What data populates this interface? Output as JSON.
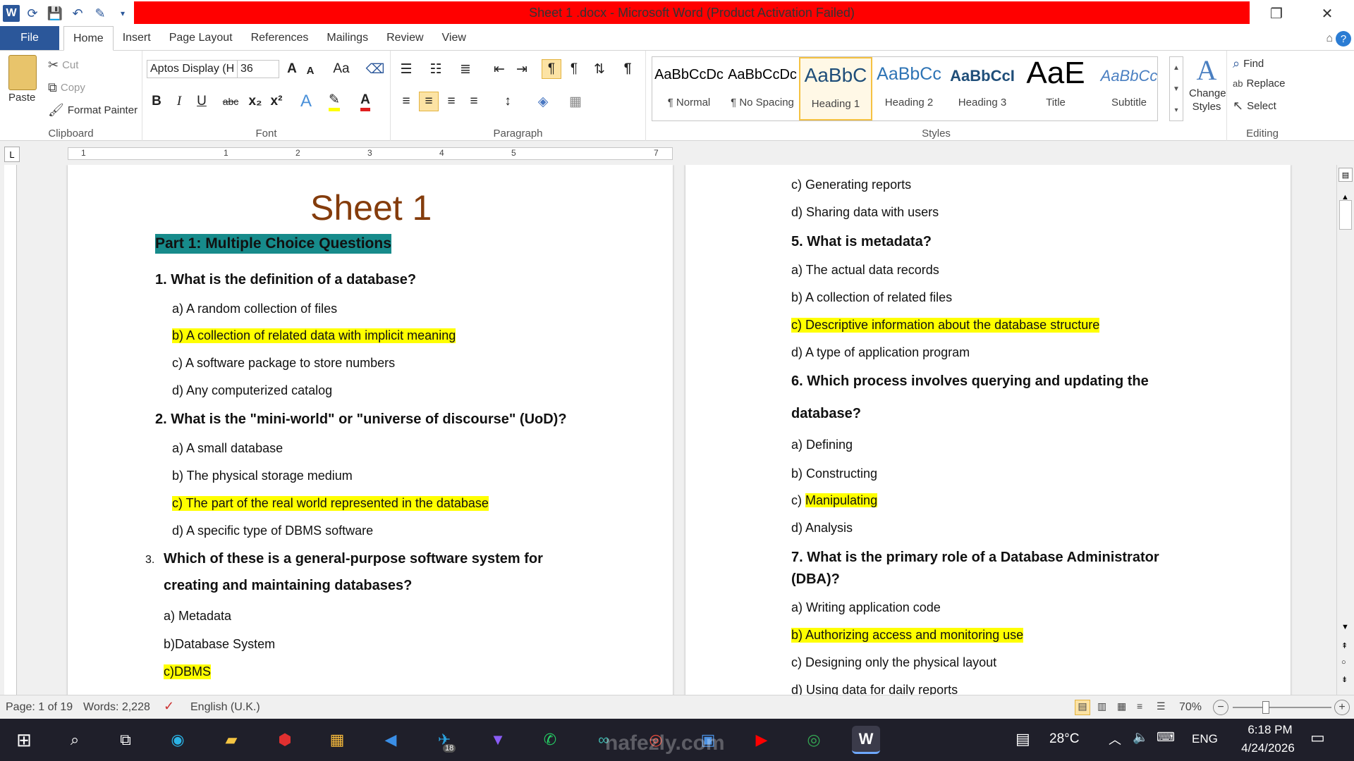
{
  "titlebar": {
    "title": "Sheet 1 .docx  -  Microsoft Word (Product Activation Failed)",
    "restore": "❐",
    "close": "✕"
  },
  "tabs": [
    "File",
    "Home",
    "Insert",
    "Page Layout",
    "References",
    "Mailings",
    "Review",
    "View"
  ],
  "clipboard": {
    "paste": "Paste",
    "cut": "Cut",
    "copy": "Copy",
    "format_painter": "Format Painter",
    "label": "Clipboard"
  },
  "font": {
    "name": "Aptos Display (H",
    "size": "36",
    "label": "Font",
    "bold": "B",
    "italic": "I",
    "underline": "U",
    "strike": "abc",
    "sub": "x₂",
    "sup": "x²",
    "grow": "A",
    "shrink": "A",
    "case": "Aa"
  },
  "paragraph": {
    "label": "Paragraph"
  },
  "styles": {
    "label": "Styles",
    "items": [
      {
        "sample": "AaBbCcDc",
        "name": "¶ Normal"
      },
      {
        "sample": "AaBbCcDc",
        "name": "¶ No Spacing"
      },
      {
        "sample": "AaBbC",
        "name": "Heading 1"
      },
      {
        "sample": "AaBbCc",
        "name": "Heading 2"
      },
      {
        "sample": "AaBbCcI",
        "name": "Heading 3"
      },
      {
        "sample": "AaE",
        "name": "Title"
      },
      {
        "sample": "AaBbCc",
        "name": "Subtitle"
      }
    ],
    "change_styles": "Change Styles"
  },
  "editing": {
    "find": "Find",
    "replace": "Replace",
    "select": "Select",
    "label": "Editing"
  },
  "ruler": {
    "marks": [
      "1",
      "1",
      "2",
      "3",
      "4",
      "5",
      "7"
    ],
    "corner": "L"
  },
  "page1": {
    "title": "Sheet 1",
    "part": "Part 1: Multiple Choice Questions",
    "q1": "1.  What is the definition of a database?",
    "q1a": "a) A random collection of files",
    "q1b": "b) A collection of related data with implicit meaning",
    "q1c": "c)  A software package to store numbers",
    "q1d": "d) Any computerized catalog",
    "q2": "2.  What is the \"mini-world\" or \"universe of discourse\" (UoD)?",
    "q2a": "a)  A small database",
    "q2b": "b) The physical storage medium",
    "q2c": "c)  The part of the real world represented in the database",
    "q2d": "d) A specific type of DBMS software",
    "q3num": "3.",
    "q3l1": "Which of these is a general-purpose software system for",
    "q3l2": "creating and maintaining databases?",
    "q3a": "a) Metadata",
    "q3b": "b)Database System",
    "q3c": "c)DBMS"
  },
  "page2": {
    "c1": "c)  Generating reports",
    "d1": "d) Sharing data with users",
    "q5": "5.  What is metadata?",
    "q5a": "a) The actual data records",
    "q5b": "b) A collection of related files",
    "q5c": "c)  Descriptive information about the database structure",
    "q5d": "d) A type of application program",
    "q6l1": "6.  Which process involves querying and updating the",
    "q6l2": "database?",
    "q6a": "a) Defining",
    "q6b": "b) Constructing",
    "q6c": "Manipulating",
    "q6cp": "c)",
    "q6d": "d) Analysis",
    "q7l1": "7.  What is the primary role of a Database Administrator",
    "q7l2": "(DBA)?",
    "q7a": "a) Writing application code",
    "q7b": "b) Authorizing access and monitoring use",
    "q7c": "c)  Designing only the physical layout",
    "q7d": "d) Using data for daily reports"
  },
  "status": {
    "page": "Page: 1 of 19",
    "words": "Words: 2,228",
    "language": "English (U.K.)",
    "zoom": "70%"
  },
  "taskbar": {
    "weather": "28°C",
    "lang": "ENG",
    "time": "6:18 PM",
    "date": "4/24/2026",
    "badge": "18",
    "watermark": "nafezly.com"
  }
}
